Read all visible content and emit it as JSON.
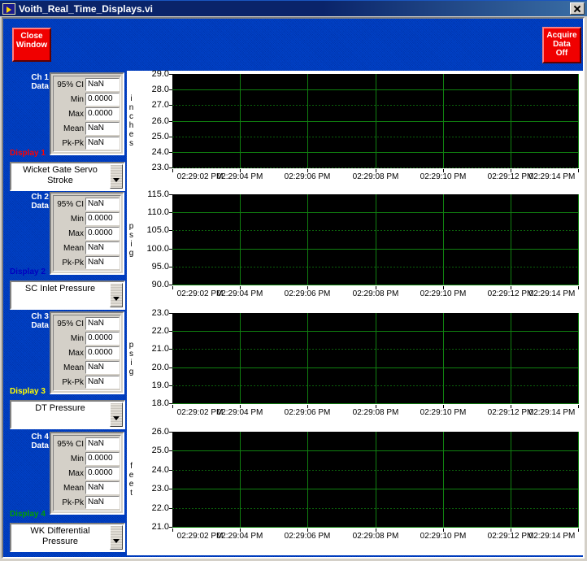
{
  "window": {
    "title": "Voith_Real_Time_Displays.vi",
    "icon": "labview-vi-icon",
    "close_icon": "close-icon"
  },
  "buttons": {
    "close_window": "Close\nWindow",
    "close_window_line1": "Close",
    "close_window_line2": "Window",
    "acquire_line1": "Acquire",
    "acquire_line2": "Data",
    "acquire_line3": "Off"
  },
  "colors": {
    "panel_background": "#0033AA",
    "button_red": "#F00000",
    "plot_background": "#000000",
    "gridline_green": "#108010",
    "display1_label": "#FF0000",
    "display2_label": "#0000C0",
    "display3_label": "#FFFF00",
    "display4_label": "#00A000"
  },
  "stat_labels": [
    "95% CI",
    "Min",
    "Max",
    "Mean",
    "Pk-Pk"
  ],
  "channels": [
    {
      "name": "Ch 1",
      "name_line2": "Data",
      "display_label": "Display 1",
      "display_color": "#FF0000",
      "signal": "Wicket Gate Servo Stroke",
      "signal_line1": "Wicket Gate Servo",
      "signal_line2": "Stroke",
      "stats": {
        "ci95": "NaN",
        "min": "0.0000",
        "max": "0.0000",
        "mean": "NaN",
        "pkpk": "NaN"
      }
    },
    {
      "name": "Ch 2",
      "name_line2": "Data",
      "display_label": "Display 2",
      "display_color": "#0000C0",
      "signal": "SC Inlet Pressure",
      "signal_line1": "SC Inlet Pressure",
      "signal_line2": "",
      "stats": {
        "ci95": "NaN",
        "min": "0.0000",
        "max": "0.0000",
        "mean": "NaN",
        "pkpk": "NaN"
      }
    },
    {
      "name": "Ch 3",
      "name_line2": "Data",
      "display_label": "Display 3",
      "display_color": "#FFFF00",
      "signal": "DT Pressure",
      "signal_line1": "DT Pressure",
      "signal_line2": "",
      "stats": {
        "ci95": "NaN",
        "min": "0.0000",
        "max": "0.0000",
        "mean": "NaN",
        "pkpk": "NaN"
      }
    },
    {
      "name": "Ch 4",
      "name_line2": "Data",
      "display_label": "Display 4",
      "display_color": "#00A000",
      "signal": "WK Differential Pressure",
      "signal_line1": "WK Differential Pressure",
      "signal_line2": "",
      "stats": {
        "ci95": "NaN",
        "min": "0.0000",
        "max": "0.0000",
        "mean": "NaN",
        "pkpk": "NaN"
      }
    }
  ],
  "chart_data": [
    {
      "type": "line",
      "title": "",
      "ylabel": "inches",
      "xlabel": "",
      "ylim": [
        23.0,
        29.0
      ],
      "yticks": [
        "29.0",
        "28.0",
        "27.0",
        "26.0",
        "25.0",
        "24.0",
        "23.0"
      ],
      "ytick_values": [
        29.0,
        28.0,
        27.0,
        26.0,
        25.0,
        24.0,
        23.0
      ],
      "x": [
        "02:29:02 PM",
        "02:29:04 PM",
        "02:29:06 PM",
        "02:29:08 PM",
        "02:29:10 PM",
        "02:29:12 PM",
        "02:29:14 PM"
      ],
      "series": [
        {
          "name": "Wicket Gate Servo Stroke",
          "values": []
        }
      ],
      "grid": true,
      "legend": "none"
    },
    {
      "type": "line",
      "title": "",
      "ylabel": "psig",
      "xlabel": "",
      "ylim": [
        90.0,
        115.0
      ],
      "yticks": [
        "115.0",
        "110.0",
        "105.0",
        "100.0",
        "95.0",
        "90.0"
      ],
      "ytick_values": [
        115.0,
        110.0,
        105.0,
        100.0,
        95.0,
        90.0
      ],
      "x": [
        "02:29:02 PM",
        "02:29:04 PM",
        "02:29:06 PM",
        "02:29:08 PM",
        "02:29:10 PM",
        "02:29:12 PM",
        "02:29:14 PM"
      ],
      "series": [
        {
          "name": "SC Inlet Pressure",
          "values": []
        }
      ],
      "grid": true,
      "legend": "none"
    },
    {
      "type": "line",
      "title": "",
      "ylabel": "psig",
      "xlabel": "",
      "ylim": [
        18.0,
        23.0
      ],
      "yticks": [
        "23.0",
        "22.0",
        "21.0",
        "20.0",
        "19.0",
        "18.0"
      ],
      "ytick_values": [
        23.0,
        22.0,
        21.0,
        20.0,
        19.0,
        18.0
      ],
      "x": [
        "02:29:02 PM",
        "02:29:04 PM",
        "02:29:06 PM",
        "02:29:08 PM",
        "02:29:10 PM",
        "02:29:12 PM",
        "02:29:14 PM"
      ],
      "series": [
        {
          "name": "DT Pressure",
          "values": []
        }
      ],
      "grid": true,
      "legend": "none"
    },
    {
      "type": "line",
      "title": "",
      "ylabel": "feet",
      "xlabel": "",
      "ylim": [
        21.0,
        26.0
      ],
      "yticks": [
        "26.0",
        "25.0",
        "24.0",
        "23.0",
        "22.0",
        "21.0"
      ],
      "ytick_values": [
        26.0,
        25.0,
        24.0,
        23.0,
        22.0,
        21.0
      ],
      "x": [
        "02:29:02 PM",
        "02:29:04 PM",
        "02:29:06 PM",
        "02:29:08 PM",
        "02:29:10 PM",
        "02:29:12 PM",
        "02:29:14 PM"
      ],
      "series": [
        {
          "name": "WK Differential Pressure",
          "values": []
        }
      ],
      "grid": true,
      "legend": "none"
    }
  ]
}
